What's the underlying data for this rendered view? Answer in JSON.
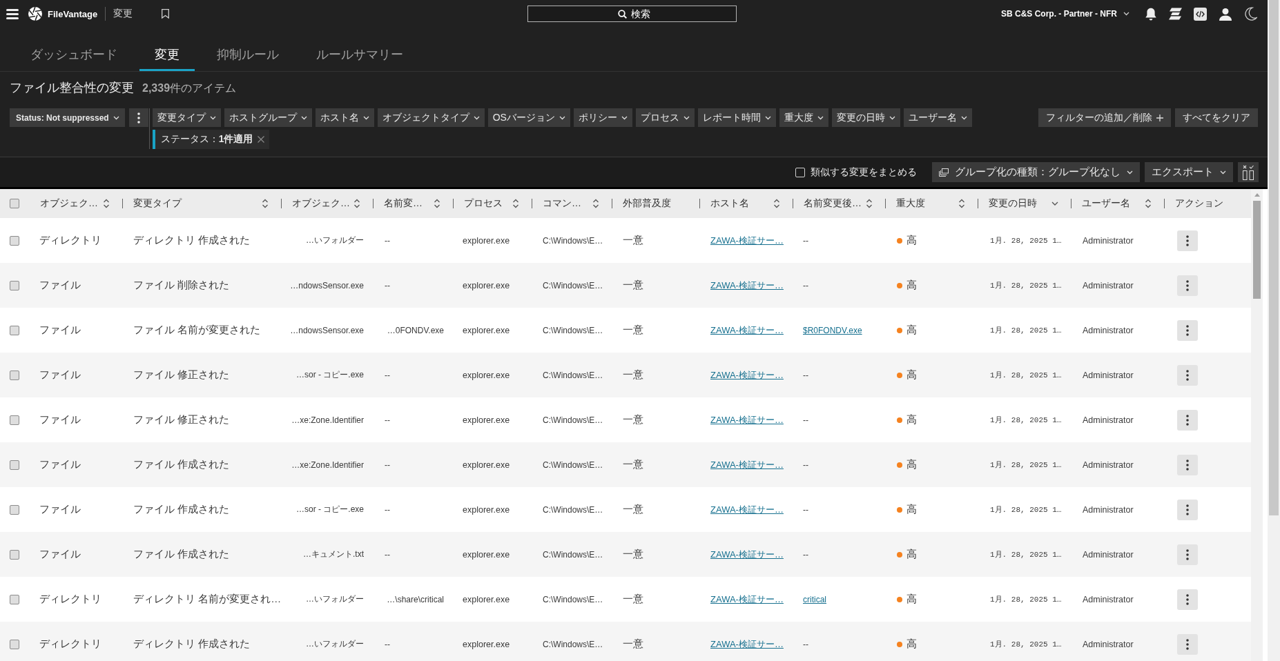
{
  "topbar": {
    "brand": "FileVantage",
    "breadcrumb": "変更",
    "search": {
      "placeholder": "検索"
    },
    "account": "SB C&S Corp. - Partner - NFR"
  },
  "tabs": [
    {
      "label": "ダッシュボード",
      "selected": false
    },
    {
      "label": "変更",
      "selected": true
    },
    {
      "label": "抑制ルール",
      "selected": false
    },
    {
      "label": "ルールサマリー",
      "selected": false
    }
  ],
  "heading": {
    "title": "ファイル整合性の変更",
    "count": "**2,339**件のアイテム"
  },
  "filters": {
    "status": "Status: Not suppressed",
    "fields": [
      "変更タイプ",
      "ホストグループ",
      "ホスト名",
      "オブジェクトタイプ",
      "OSバージョン",
      "ポリシー",
      "プロセス",
      "レポート時間",
      "重大度",
      "変更の日時",
      "ユーザー名"
    ],
    "add_remove": "フィルターの追加／削除",
    "clear_all": "すべてをクリア",
    "applied": [
      {
        "label": "ステータス：**1件適用**"
      }
    ]
  },
  "toolbar": {
    "merge_similar": {
      "label": "類似する変更をまとめる",
      "checked": false
    },
    "grouping": "グループ化の種類：グループ化なし",
    "export": "エクスポート"
  },
  "table": {
    "select_all": {
      "checked": false
    },
    "columns": [
      {
        "label": "オブジェク…",
        "sortable": true,
        "sorted": false
      },
      {
        "label": "変更タイプ",
        "sortable": true,
        "sorted": false
      },
      {
        "label": "オブジェク…",
        "sortable": true,
        "sorted": false
      },
      {
        "label": "名前変…",
        "sortable": true,
        "sorted": false
      },
      {
        "label": "プロセス",
        "sortable": true,
        "sorted": false
      },
      {
        "label": "コマン…",
        "sortable": true,
        "sorted": false
      },
      {
        "label": "外部普及度",
        "sortable": false,
        "sorted": false
      },
      {
        "label": "ホスト名",
        "sortable": true,
        "sorted": false
      },
      {
        "label": "名前変更後…",
        "sortable": true,
        "sorted": false
      },
      {
        "label": "重大度",
        "sortable": true,
        "sorted": false
      },
      {
        "label": "変更の日時",
        "sortable": true,
        "sorted": true
      },
      {
        "label": "ユーザー名",
        "sortable": true,
        "sorted": false
      },
      {
        "label": "アクション",
        "sortable": false,
        "sorted": false
      }
    ],
    "rows": [
      {
        "checked": false,
        "object_type": "ディレクトリ",
        "change_type": "ディレクトリ 作成された",
        "object": "…いフォルダー",
        "renamed_from": {
          "kind": "empty",
          "text": "--"
        },
        "process": "explorer.exe",
        "command": "C:\\Windows\\E…",
        "prevalence": "一意",
        "host": "ZAWA-検証サー…",
        "renamed_to": {
          "kind": "empty",
          "text": "--"
        },
        "severity": {
          "label": "高",
          "color": "#f5821f"
        },
        "changed_at": "1月. 28, 2025 1…",
        "user": "Administrator"
      },
      {
        "checked": false,
        "object_type": "ファイル",
        "change_type": "ファイル 削除された",
        "object": "…ndowsSensor.exe",
        "renamed_from": {
          "kind": "empty",
          "text": "--"
        },
        "process": "explorer.exe",
        "command": "C:\\Windows\\E…",
        "prevalence": "一意",
        "host": "ZAWA-検証サー…",
        "renamed_to": {
          "kind": "empty",
          "text": "--"
        },
        "severity": {
          "label": "高",
          "color": "#f5821f"
        },
        "changed_at": "1月. 28, 2025 1…",
        "user": "Administrator"
      },
      {
        "checked": false,
        "object_type": "ファイル",
        "change_type": "ファイル 名前が変更された",
        "object": "…ndowsSensor.exe",
        "renamed_from": {
          "kind": "path",
          "text": "…0FONDV.exe"
        },
        "process": "explorer.exe",
        "command": "C:\\Windows\\E…",
        "prevalence": "一意",
        "host": "ZAWA-検証サー…",
        "renamed_to": {
          "kind": "link",
          "text": "$R0FONDV.exe"
        },
        "severity": {
          "label": "高",
          "color": "#f5821f"
        },
        "changed_at": "1月. 28, 2025 1…",
        "user": "Administrator"
      },
      {
        "checked": false,
        "object_type": "ファイル",
        "change_type": "ファイル 修正された",
        "object": "…sor - コピー.exe",
        "renamed_from": {
          "kind": "empty",
          "text": "--"
        },
        "process": "explorer.exe",
        "command": "C:\\Windows\\E…",
        "prevalence": "一意",
        "host": "ZAWA-検証サー…",
        "renamed_to": {
          "kind": "empty",
          "text": "--"
        },
        "severity": {
          "label": "高",
          "color": "#f5821f"
        },
        "changed_at": "1月. 28, 2025 1…",
        "user": "Administrator"
      },
      {
        "checked": false,
        "object_type": "ファイル",
        "change_type": "ファイル 修正された",
        "object": "…xe:Zone.Identifier",
        "renamed_from": {
          "kind": "empty",
          "text": "--"
        },
        "process": "explorer.exe",
        "command": "C:\\Windows\\E…",
        "prevalence": "一意",
        "host": "ZAWA-検証サー…",
        "renamed_to": {
          "kind": "empty",
          "text": "--"
        },
        "severity": {
          "label": "高",
          "color": "#f5821f"
        },
        "changed_at": "1月. 28, 2025 1…",
        "user": "Administrator"
      },
      {
        "checked": false,
        "object_type": "ファイル",
        "change_type": "ファイル 作成された",
        "object": "…xe:Zone.Identifier",
        "renamed_from": {
          "kind": "empty",
          "text": "--"
        },
        "process": "explorer.exe",
        "command": "C:\\Windows\\E…",
        "prevalence": "一意",
        "host": "ZAWA-検証サー…",
        "renamed_to": {
          "kind": "empty",
          "text": "--"
        },
        "severity": {
          "label": "高",
          "color": "#f5821f"
        },
        "changed_at": "1月. 28, 2025 1…",
        "user": "Administrator"
      },
      {
        "checked": false,
        "object_type": "ファイル",
        "change_type": "ファイル 作成された",
        "object": "…sor - コピー.exe",
        "renamed_from": {
          "kind": "empty",
          "text": "--"
        },
        "process": "explorer.exe",
        "command": "C:\\Windows\\E…",
        "prevalence": "一意",
        "host": "ZAWA-検証サー…",
        "renamed_to": {
          "kind": "empty",
          "text": "--"
        },
        "severity": {
          "label": "高",
          "color": "#f5821f"
        },
        "changed_at": "1月. 28, 2025 1…",
        "user": "Administrator"
      },
      {
        "checked": false,
        "object_type": "ファイル",
        "change_type": "ファイル 作成された",
        "object": "…キュメント.txt",
        "renamed_from": {
          "kind": "empty",
          "text": "--"
        },
        "process": "explorer.exe",
        "command": "C:\\Windows\\E…",
        "prevalence": "一意",
        "host": "ZAWA-検証サー…",
        "renamed_to": {
          "kind": "empty",
          "text": "--"
        },
        "severity": {
          "label": "高",
          "color": "#f5821f"
        },
        "changed_at": "1月. 28, 2025 1…",
        "user": "Administrator"
      },
      {
        "checked": false,
        "object_type": "ディレクトリ",
        "change_type": "ディレクトリ 名前が変更され…",
        "object": "…いフォルダー",
        "renamed_from": {
          "kind": "path",
          "text": "…\\share\\critical"
        },
        "process": "explorer.exe",
        "command": "C:\\Windows\\E…",
        "prevalence": "一意",
        "host": "ZAWA-検証サー…",
        "renamed_to": {
          "kind": "link",
          "text": "critical"
        },
        "severity": {
          "label": "高",
          "color": "#f5821f"
        },
        "changed_at": "1月. 28, 2025 1…",
        "user": "Administrator"
      },
      {
        "checked": false,
        "object_type": "ディレクトリ",
        "change_type": "ディレクトリ 作成された",
        "object": "…いフォルダー",
        "renamed_from": {
          "kind": "empty",
          "text": "--"
        },
        "process": "explorer.exe",
        "command": "C:\\Windows\\E…",
        "prevalence": "一意",
        "host": "ZAWA-検証サー…",
        "renamed_to": {
          "kind": "empty",
          "text": "--"
        },
        "severity": {
          "label": "高",
          "color": "#f5821f"
        },
        "changed_at": "1月. 28, 2025 1…",
        "user": "Administrator"
      }
    ]
  }
}
